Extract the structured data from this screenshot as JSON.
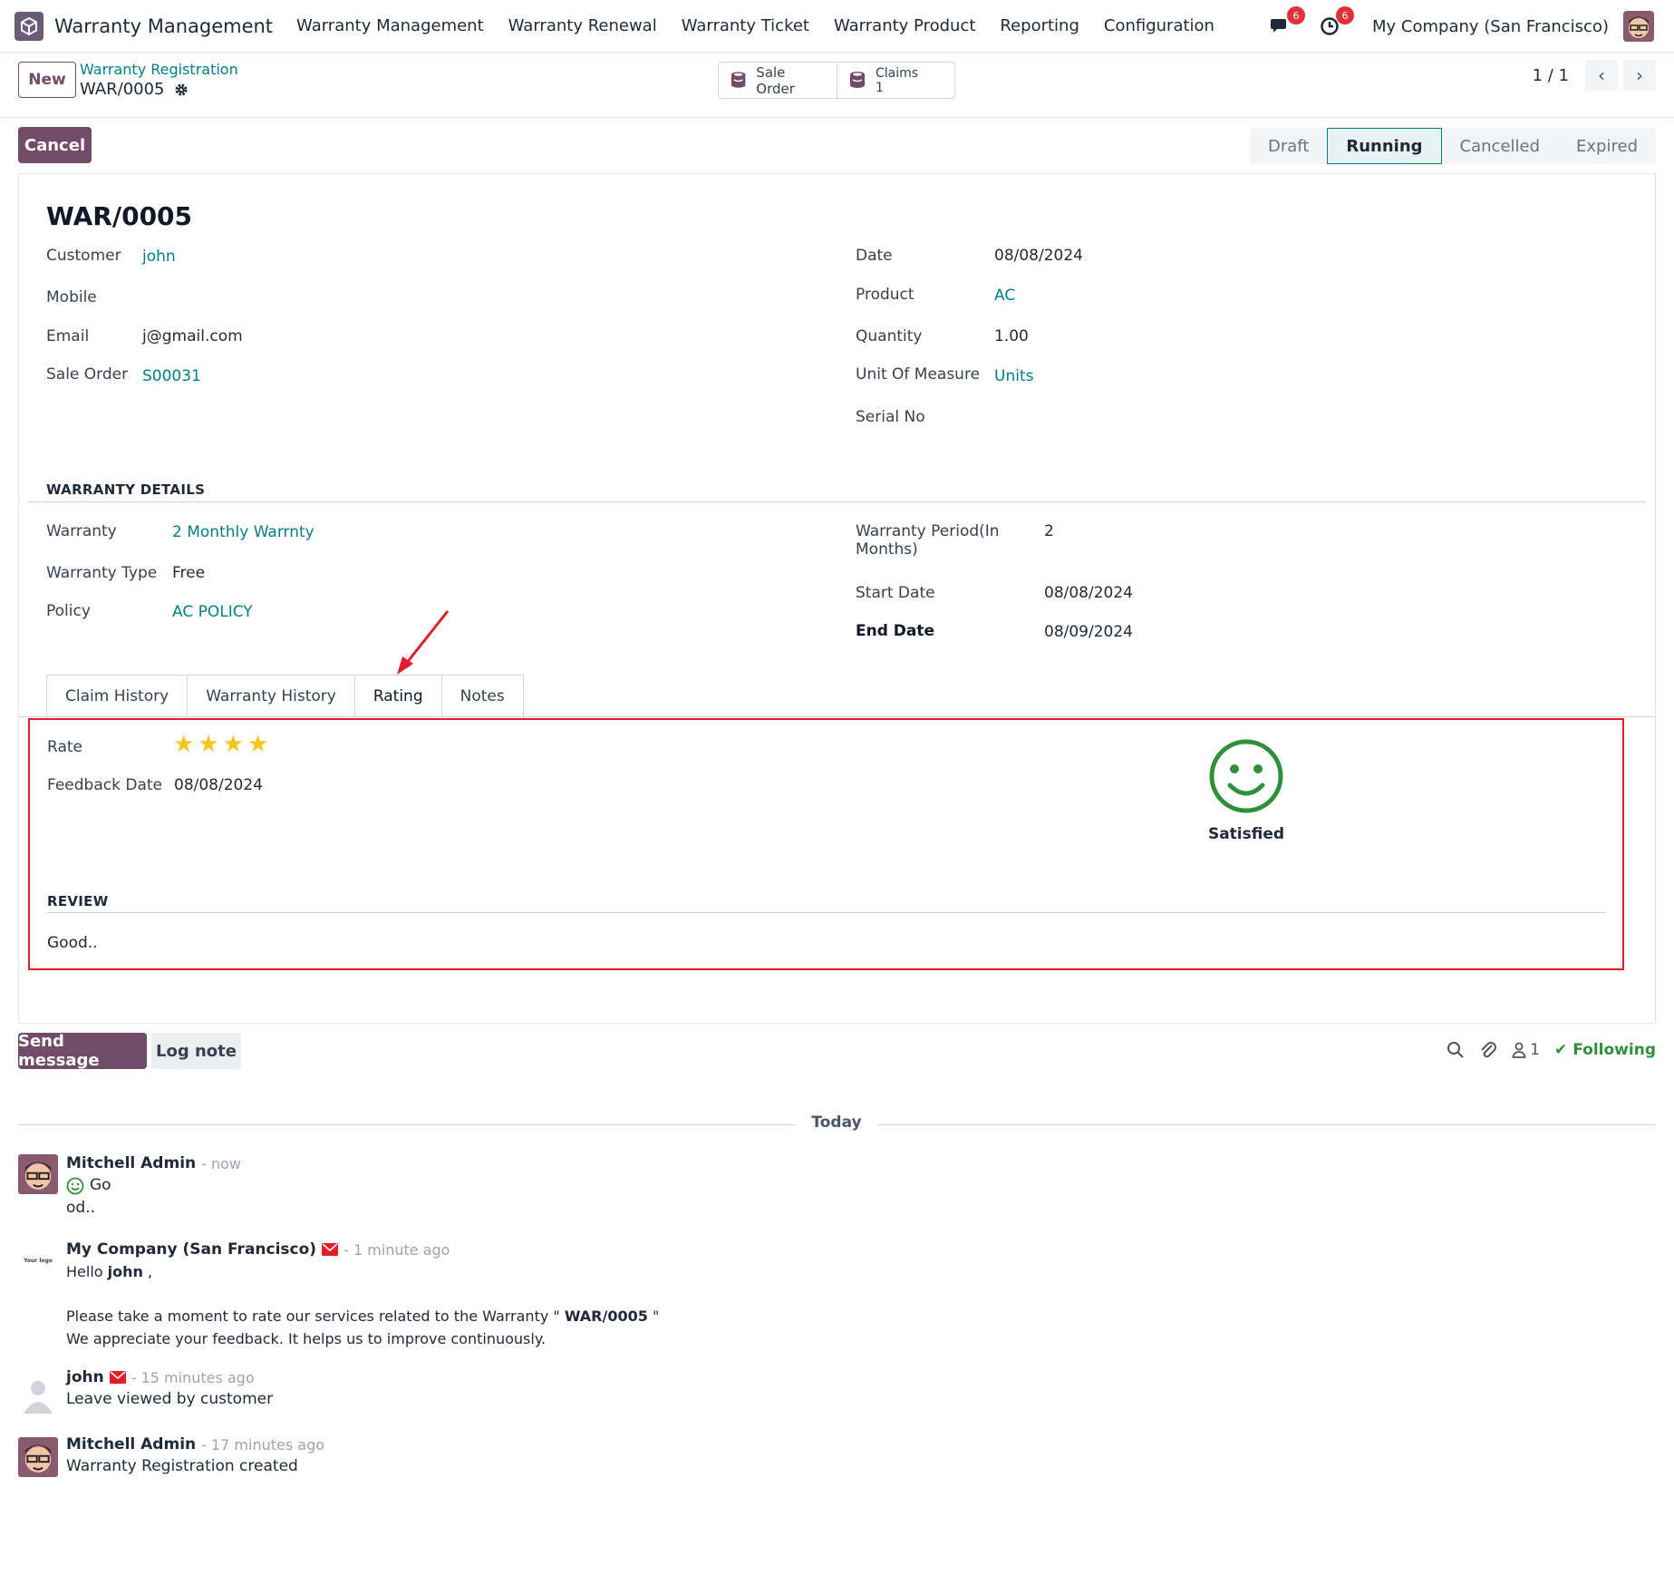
{
  "navbar": {
    "app_name": "Warranty Management",
    "menu": [
      "Warranty Management",
      "Warranty Renewal",
      "Warranty Ticket",
      "Warranty Product",
      "Reporting",
      "Configuration"
    ],
    "messages_badge": "6",
    "activities_badge": "6",
    "company": "My Company (San Francisco)"
  },
  "control": {
    "new_label": "New",
    "breadcrumb_parent": "Warranty Registration",
    "breadcrumb_current": "WAR/0005",
    "smart_buttons": [
      {
        "label": "Sale Order",
        "icon": "sale-order-icon"
      },
      {
        "label": "Claims",
        "value": "1",
        "icon": "claims-icon"
      }
    ],
    "pager": "1 / 1"
  },
  "actions": {
    "cancel_label": "Cancel",
    "statuses": [
      "Draft",
      "Running",
      "Cancelled",
      "Expired"
    ],
    "active_status": "Running"
  },
  "form": {
    "title": "WAR/0005",
    "left": [
      {
        "label": "Customer",
        "value": "john",
        "link": true
      },
      {
        "label": "Mobile",
        "value": ""
      },
      {
        "label": "Email",
        "value": "j@gmail.com"
      },
      {
        "label": "Sale Order",
        "value": "S00031",
        "link": true
      }
    ],
    "right": [
      {
        "label": "Date",
        "value": "08/08/2024"
      },
      {
        "label": "Product",
        "value": "AC",
        "link": true
      },
      {
        "label": "Quantity",
        "value": "1.00"
      },
      {
        "label": "Unit Of Measure",
        "value": "Units",
        "link": true
      },
      {
        "label": "Serial No",
        "value": ""
      }
    ],
    "warranty_section": "WARRANTY DETAILS",
    "warranty_left": [
      {
        "label": "Warranty",
        "value": "2 Monthly Warrnty",
        "link": true
      },
      {
        "label": "Warranty Type",
        "value": "Free"
      },
      {
        "label": "Policy",
        "value": "AC POLICY",
        "link": true
      }
    ],
    "warranty_right": [
      {
        "label_line1": "Warranty Period(In",
        "label_line2": "Months)",
        "value": "2"
      },
      {
        "label": "Start Date",
        "value": "08/08/2024"
      },
      {
        "label": "End Date",
        "value": "08/09/2024"
      }
    ],
    "tabs": [
      "Claim History",
      "Warranty History",
      "Rating",
      "Notes"
    ],
    "active_tab": "Rating",
    "rating": {
      "rate_label": "Rate",
      "stars": 4,
      "feedback_date_label": "Feedback Date",
      "feedback_date": "08/08/2024",
      "mood": "Satisfied",
      "review_header": "REVIEW",
      "review_text": "Good.."
    }
  },
  "chatter": {
    "send_label": "Send message",
    "log_label": "Log note",
    "followers_count": "1",
    "following_label": "Following",
    "today_label": "Today",
    "messages": [
      {
        "author": "Mitchell Admin",
        "time": "- now",
        "line1": "Go",
        "line2": "od.."
      },
      {
        "author": "My Company (San Francisco)",
        "time": "- 1 minute ago",
        "greeting_pre": "Hello ",
        "greeting_name": "john",
        "greeting_post": " ,",
        "body1_pre": "Please take a moment to rate our services related to the Warranty \" ",
        "body1_bold": "WAR/0005",
        "body1_post": " \"",
        "body2": "We appreciate your feedback. It helps us to improve continuously.",
        "logo_text": "Your logo"
      },
      {
        "author": "john",
        "time": "- 15 minutes ago",
        "line1": "Leave viewed by customer"
      },
      {
        "author": "Mitchell Admin",
        "time": "- 17 minutes ago",
        "line1": "Warranty Registration created"
      }
    ]
  },
  "colors": {
    "primary": "#714b67",
    "link": "#017e84",
    "highlight": "#e11d2a",
    "star": "#f5c518",
    "satisfied": "#2f8f3a"
  }
}
